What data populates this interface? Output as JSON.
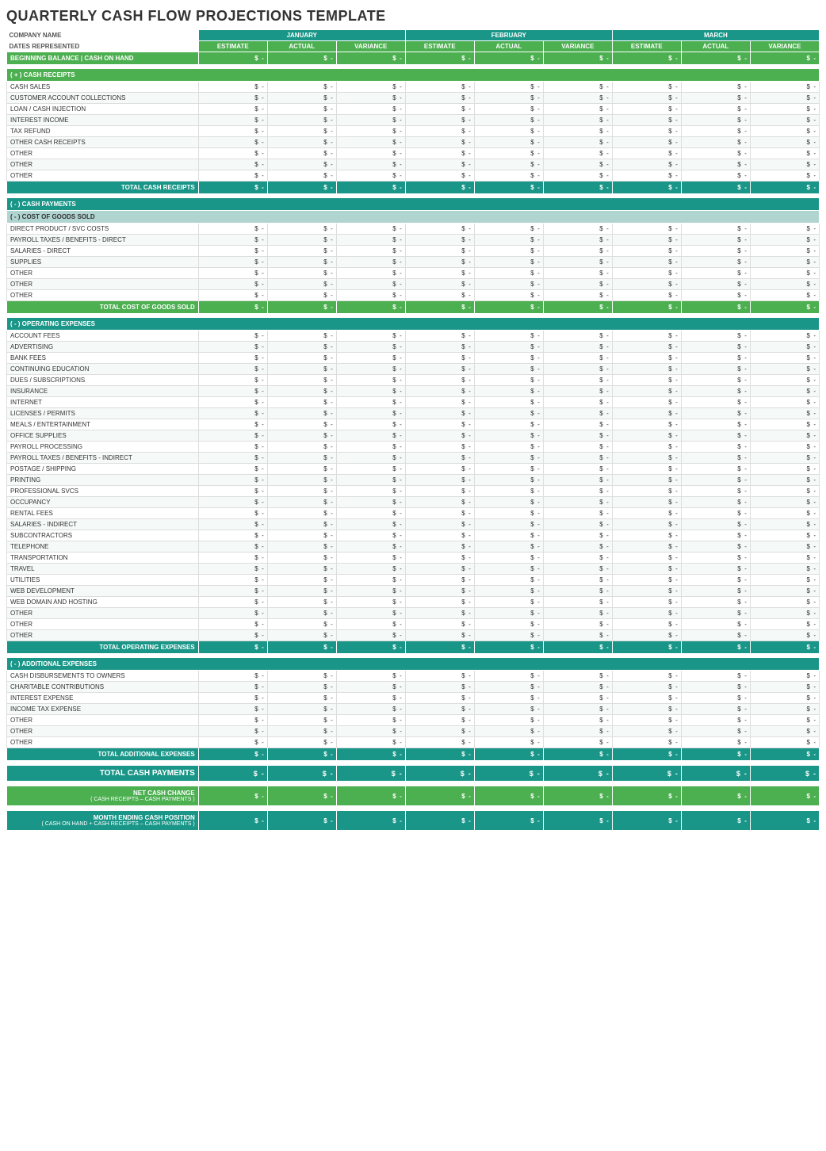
{
  "title": "QUARTERLY CASH FLOW PROJECTIONS TEMPLATE",
  "labels": {
    "company_name": "COMPANY NAME",
    "dates_represented": "DATES REPRESENTED",
    "january": "JANUARY",
    "february": "FEBRUARY",
    "march": "MARCH",
    "estimate": "ESTIMATE",
    "actual": "ACTUAL",
    "variance": "VARIANCE",
    "beginning_balance": "BEGINNING BALANCE | CASH ON HAND",
    "cash_receipts_header": "( + )  CASH RECEIPTS",
    "cash_sales": "CASH SALES",
    "customer_account_collections": "CUSTOMER ACCOUNT COLLECTIONS",
    "loan_cash_injection": "LOAN / CASH INJECTION",
    "interest_income": "INTEREST INCOME",
    "tax_refund": "TAX REFUND",
    "other_cash_receipts": "OTHER CASH RECEIPTS",
    "other1": "OTHER",
    "other2": "OTHER",
    "other3": "OTHER",
    "total_cash_receipts": "TOTAL CASH RECEIPTS",
    "cash_payments_header": "( - )  CASH PAYMENTS",
    "cost_of_goods_header": "( - )  COST OF GOODS SOLD",
    "direct_product": "DIRECT PRODUCT / SVC COSTS",
    "payroll_taxes_direct": "PAYROLL TAXES / BENEFITS - DIRECT",
    "salaries_direct": "SALARIES - DIRECT",
    "supplies": "SUPPLIES",
    "other_cogs1": "OTHER",
    "other_cogs2": "OTHER",
    "other_cogs3": "OTHER",
    "total_cost_of_goods_sold": "TOTAL COST OF GOODS SOLD",
    "operating_expenses_header": "( - )  OPERATING EXPENSES",
    "account_fees": "ACCOUNT FEES",
    "advertising": "ADVERTISING",
    "bank_fees": "BANK FEES",
    "continuing_education": "CONTINUING EDUCATION",
    "dues_subscriptions": "DUES / SUBSCRIPTIONS",
    "insurance": "INSURANCE",
    "internet": "INTERNET",
    "licenses_permits": "LICENSES / PERMITS",
    "meals_entertainment": "MEALS / ENTERTAINMENT",
    "office_supplies": "OFFICE SUPPLIES",
    "payroll_processing": "PAYROLL PROCESSING",
    "payroll_taxes_indirect": "PAYROLL TAXES / BENEFITS - INDIRECT",
    "postage_shipping": "POSTAGE / SHIPPING",
    "printing": "PRINTING",
    "professional_svcs": "PROFESSIONAL SVCS",
    "occupancy": "OCCUPANCY",
    "rental_fees": "RENTAL FEES",
    "salaries_indirect": "SALARIES - INDIRECT",
    "subcontractors": "SUBCONTRACTORS",
    "telephone": "TELEPHONE",
    "transportation": "TRANSPORTATION",
    "travel": "TRAVEL",
    "utilities": "UTILITIES",
    "web_development": "WEB DEVELOPMENT",
    "web_domain_hosting": "WEB DOMAIN AND HOSTING",
    "other_op1": "OTHER",
    "other_op2": "OTHER",
    "other_op3": "OTHER",
    "total_operating_expenses": "TOTAL OPERATING EXPENSES",
    "additional_expenses_header": "( - )  ADDITIONAL EXPENSES",
    "cash_disbursements": "CASH DISBURSEMENTS TO OWNERS",
    "charitable_contributions": "CHARITABLE CONTRIBUTIONS",
    "interest_expense": "INTEREST EXPENSE",
    "income_tax_expense": "INCOME TAX EXPENSE",
    "other_add1": "OTHER",
    "other_add2": "OTHER",
    "other_add3": "OTHER",
    "total_additional_expenses": "TOTAL ADDITIONAL EXPENSES",
    "total_cash_payments": "TOTAL CASH PAYMENTS",
    "net_cash_change": "NET CASH CHANGE",
    "net_cash_change_sub": "( CASH RECEIPTS – CASH PAYMENTS )",
    "month_ending_cash_position": "MONTH ENDING CASH POSITION",
    "month_ending_sub": "( CASH ON HAND + CASH RECEIPTS – CASH PAYMENTS )",
    "dollar": "$",
    "dash": "-"
  }
}
